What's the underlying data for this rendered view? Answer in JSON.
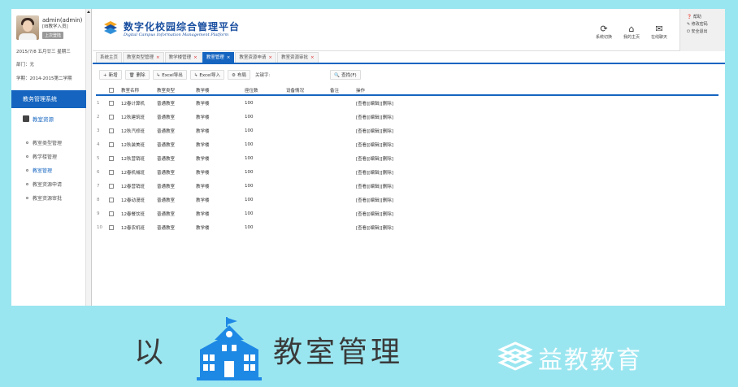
{
  "user": {
    "name": "admin(admin)",
    "role": "[IB教学入员]",
    "badge": "上次登陆",
    "date": "2015/7/8  五月廿三  星期三",
    "dept": "部门：无",
    "term": "学期：2014-2015第二学期"
  },
  "sidebar": {
    "system": "教务管理系统",
    "group": "教室资源",
    "items": [
      "教室类型管理",
      "教学楼管理",
      "教室管理",
      "教室资源申请",
      "教室资源审批"
    ],
    "active_index": 2
  },
  "header": {
    "title": "数字化校园综合管理平台",
    "subtitle": "Digital Campus Information Management Platform",
    "buttons": [
      "系统切换",
      "我的主页",
      "在线聊天"
    ],
    "right_menu": [
      "帮助",
      "修改密码",
      "安全退出"
    ]
  },
  "tabs": [
    {
      "label": "系统主页",
      "closable": false
    },
    {
      "label": "教室类型管理",
      "closable": true
    },
    {
      "label": "教学楼管理",
      "closable": true
    },
    {
      "label": "教室管理",
      "closable": true,
      "active": true
    },
    {
      "label": "教室资源申请",
      "closable": true
    },
    {
      "label": "教室资源审批",
      "closable": true
    }
  ],
  "toolbar": {
    "add": "新增",
    "delete": "删除",
    "export": "Excel导出",
    "import": "Excel导入",
    "layout": "布局",
    "keyword_label": "关键字:",
    "search": "查找(F)"
  },
  "table": {
    "headers": [
      "教室名称",
      "教室类型",
      "教学楼",
      "座位数",
      "设备情况",
      "备注",
      "操作"
    ],
    "rows": [
      [
        "12春计算机",
        "普通教室",
        "教学楼",
        "100",
        "",
        "",
        "[查看][编辑][删除]"
      ],
      [
        "12秋建筑班",
        "普通教室",
        "教学楼",
        "100",
        "",
        "",
        "[查看][编辑][删除]"
      ],
      [
        "12秋汽修班",
        "普通教室",
        "教学楼",
        "100",
        "",
        "",
        "[查看][编辑][删除]"
      ],
      [
        "12秋装美班",
        "普通教室",
        "教学楼",
        "100",
        "",
        "",
        "[查看][编辑][删除]"
      ],
      [
        "12秋营销班",
        "普通教室",
        "教学楼",
        "100",
        "",
        "",
        "[查看][编辑][删除]"
      ],
      [
        "12春机械班",
        "普通教室",
        "教学楼",
        "100",
        "",
        "",
        "[查看][编辑][删除]"
      ],
      [
        "12春营销班",
        "普通教室",
        "教学楼",
        "100",
        "",
        "",
        "[查看][编辑][删除]"
      ],
      [
        "12春动漫班",
        "普通教室",
        "教学楼",
        "100",
        "",
        "",
        "[查看][编辑][删除]"
      ],
      [
        "12春餐饮班",
        "普通教室",
        "教学楼",
        "100",
        "",
        "",
        "[查看][编辑][删除]"
      ],
      [
        "12春农机班",
        "普通教室",
        "教学楼",
        "100",
        "",
        "",
        "[查看][编辑][删除]"
      ]
    ]
  },
  "caption": {
    "prefix": "以",
    "main": "教室管理",
    "brand": "益教教育"
  },
  "colors": {
    "accent": "#1565c0",
    "background": "#9ae6f0"
  }
}
